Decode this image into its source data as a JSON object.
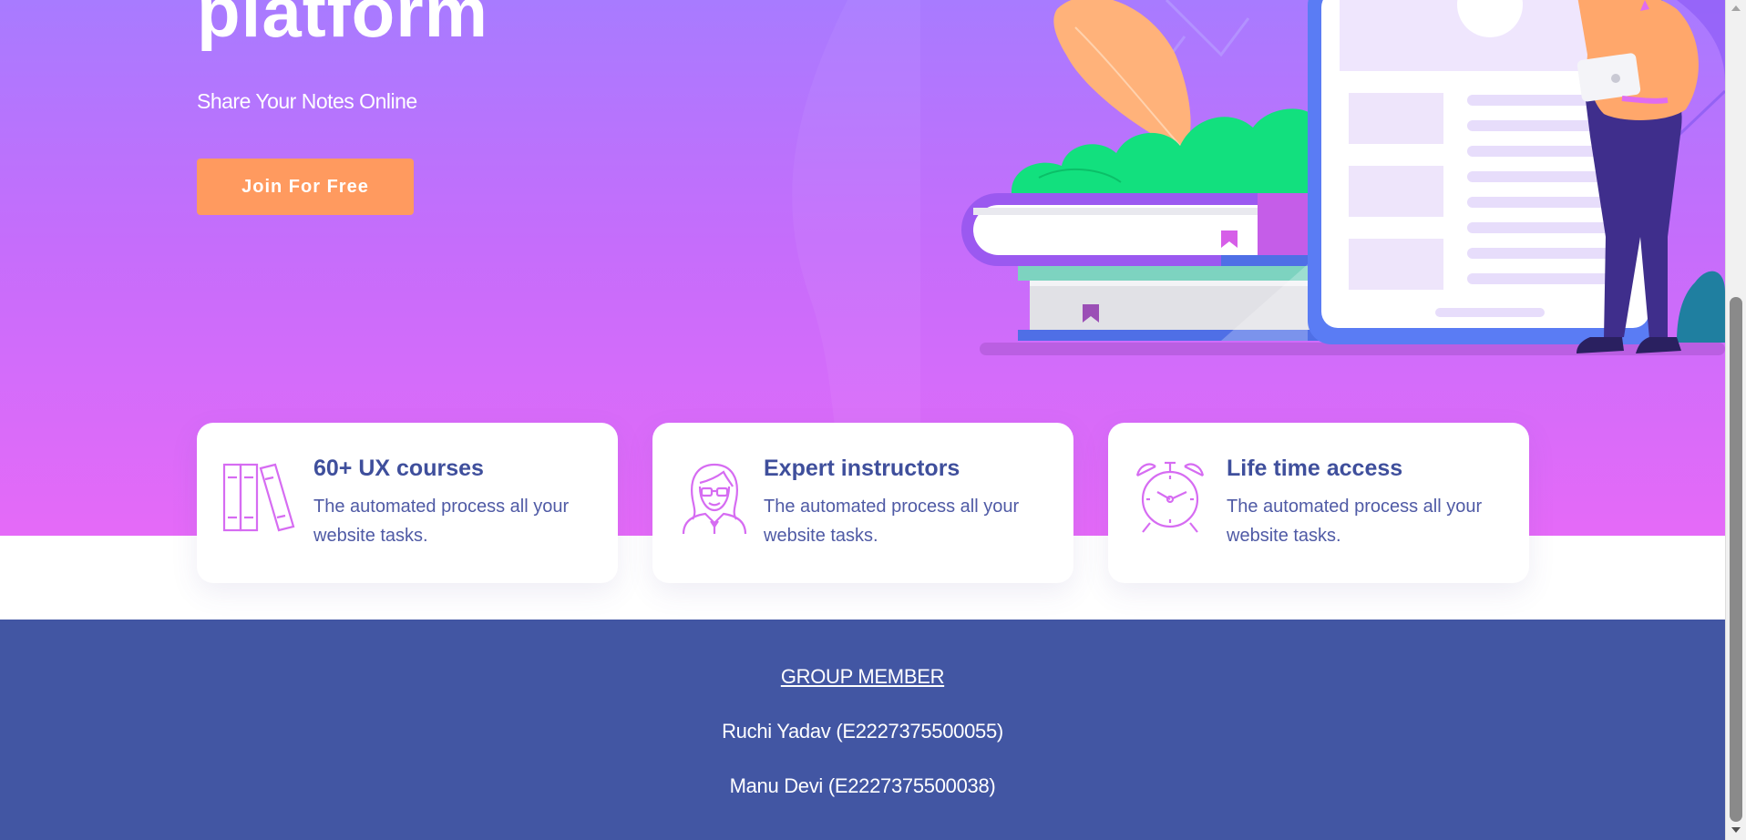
{
  "hero": {
    "title": "platform",
    "subtitle": "Share Your Notes Online",
    "cta_label": "Join For Free"
  },
  "features": [
    {
      "icon": "books-icon",
      "title": "60+ UX courses",
      "description": "The automated process all your website tasks."
    },
    {
      "icon": "instructor-icon",
      "title": "Expert instructors",
      "description": "The automated process all your website tasks."
    },
    {
      "icon": "alarm-clock-icon",
      "title": "Life time access",
      "description": "The automated process all your website tasks."
    }
  ],
  "footer": {
    "heading": "GROUP MEMBER",
    "members": [
      "Ruchi Yadav (E2227375500055)",
      "Manu Devi (E2227375500038)"
    ]
  },
  "colors": {
    "hero_gradient_top": "#a87bff",
    "hero_gradient_bottom": "#e56af8",
    "cta_button": "#ff9a5f",
    "footer_background": "#4256a3",
    "feature_title": "#3f4f9c",
    "feature_icon_stroke": "#d66cf2"
  }
}
